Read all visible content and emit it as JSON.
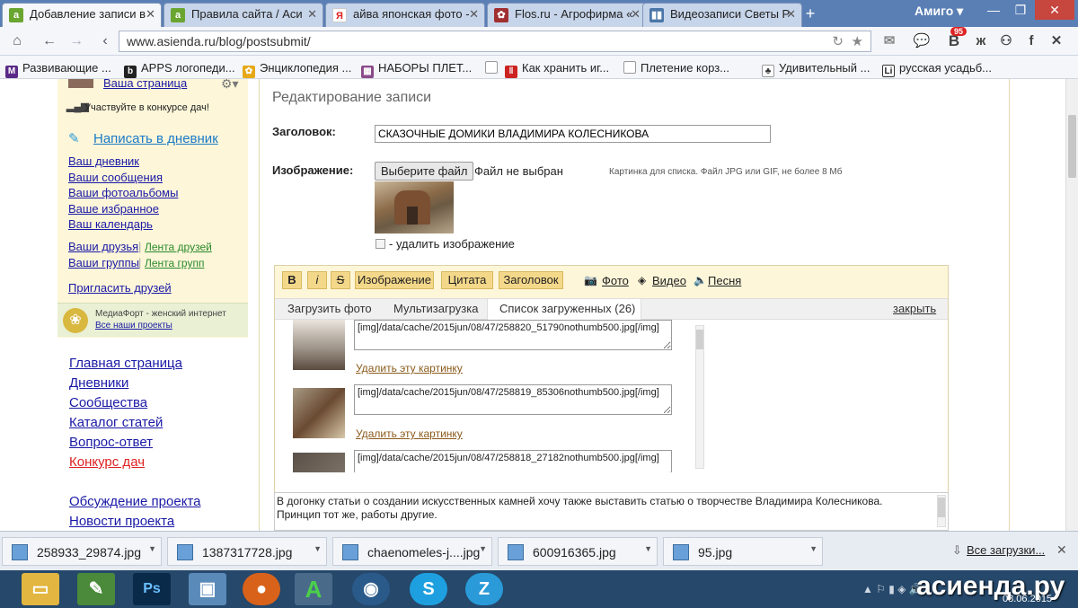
{
  "browser": {
    "tabs": [
      {
        "label": "Добавление записи в",
        "active": true
      },
      {
        "label": "Правила сайта / Аси"
      },
      {
        "label": "айва японская фото -"
      },
      {
        "label": "Flos.ru - Агрофирма «"
      },
      {
        "label": "Видеозаписи Светы Р"
      }
    ],
    "new_tab": "+",
    "profile": "Амиго ▾",
    "url": "www.asienda.ru/blog/postsubmit/",
    "badge": "95",
    "bookmarks": [
      "Развивающие ...",
      "APPS логопеди...",
      "Энциклопедия ...",
      "НАБОРЫ ПЛЕТ...",
      "Как хранить иг...",
      "Плетение корз...",
      "Удивительный ...",
      "русская усадьб..."
    ]
  },
  "sidebar": {
    "my_page": "Ваша страница",
    "contest": "Участвуйте в конкурсе дач!",
    "write": "Написать в дневник",
    "links": [
      "Ваш дневник",
      "Ваши сообщения",
      "Ваши фотоальбомы",
      "Ваше избранное",
      "Ваш календарь"
    ],
    "friends": "Ваши друзья",
    "friends_feed": "Лента друзей",
    "groups": "Ваши группы",
    "groups_feed": "Лента групп",
    "invite": "Пригласить друзей",
    "mediafort": "МедиаФорт - женский интернет",
    "projects": "Все наши проекты",
    "main_links": [
      "Главная страница",
      "Дневники",
      "Сообщества",
      "Каталог статей",
      "Вопрос-ответ"
    ],
    "contest_link": "Конкурс дач",
    "bottom_links": [
      "Обсуждение проекта",
      "Новости проекта"
    ]
  },
  "form": {
    "heading": "Редактирование записи",
    "title_label": "Заголовок:",
    "title_value": "СКАЗОЧНЫЕ ДОМИКИ ВЛАДИМИРА КОЛЕСНИКОВА",
    "image_label": "Изображение:",
    "choose_file": "Выберите файл",
    "no_file": "Файл не выбран",
    "image_hint": "Картинка для списка. Файл JPG или GIF, не более 8 Мб",
    "delete_image": "- удалить изображение"
  },
  "editor": {
    "tools": [
      "B",
      "i",
      "S",
      "Изображение",
      "Цитата",
      "Заголовок"
    ],
    "media": [
      "Фото",
      "Видео",
      "Песня"
    ],
    "tabs": [
      "Загрузить фото",
      "Мультизагрузка",
      "Список загруженных (26)"
    ],
    "close": "закрыть",
    "uploads": [
      {
        "code": "[img]/data/cache/2015jun/08/47/258820_51790nothumb500.jpg[/img]",
        "delete": "Удалить эту картинку"
      },
      {
        "code": "[img]/data/cache/2015jun/08/47/258819_85306nothumb500.jpg[/img]",
        "delete": "Удалить эту картинку"
      },
      {
        "code": "[img]/data/cache/2015jun/08/47/258818_27182nothumb500.jpg[/img]"
      }
    ],
    "body_text": "В догонку статьи о создании искусственных камней хочу также выставить статью о творчестве Владимира Колесникова. Принцип тот же, работы другие."
  },
  "downloads": {
    "items": [
      "258933_29874.jpg",
      "1387317728.jpg",
      "chaenomeles-j....jpg",
      "600916365.jpg",
      "95.jpg"
    ],
    "all": "Все загрузки..."
  },
  "taskbar": {
    "watermark": "асиенда.ру",
    "date": "08.06.2015"
  }
}
